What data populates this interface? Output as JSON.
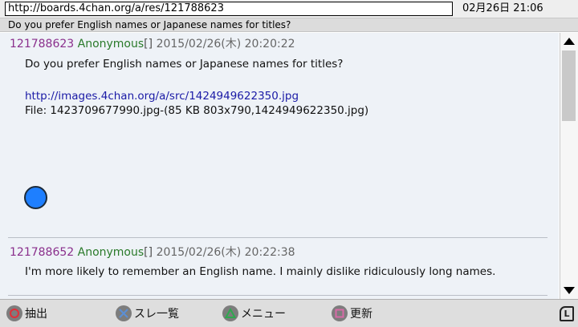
{
  "address_bar": {
    "url": "http://boards.4chan.org/a/res/121788623"
  },
  "clock": {
    "date_time": "02月26日  21:06"
  },
  "thread": {
    "title": "Do you prefer English names or Japanese names for titles?"
  },
  "posts": [
    {
      "number": "121788623",
      "name": "Anonymous",
      "mail": "[]",
      "date": "2015/02/26(木) 20:20:22",
      "body": "Do you prefer English names or Japanese names for titles?",
      "image_link": "http://images.4chan.org/a/src/1424949622350.jpg",
      "file_info": "File: 1423709677990.jpg-(85 KB 803x790,1424949622350.jpg)"
    },
    {
      "number": "121788652",
      "name": "Anonymous",
      "mail": "[]",
      "date": "2015/02/26(木) 20:22:38",
      "body": "I'm more likely to remember an English name. I mainly dislike ridiculously long names."
    }
  ],
  "bottom_bar": {
    "circle_label": "抽出",
    "cross_label": "スレ一覧",
    "triangle_label": "メニュー",
    "square_label": "更新",
    "l_label": "L"
  },
  "colors": {
    "post_number": "#8a2f8c",
    "post_name": "#2a7a2a",
    "link": "#1a1aa6",
    "marker": "#1e7fff",
    "circle_button": "#e0303a",
    "cross_button": "#5b8fd6",
    "triangle_button": "#2fa84f",
    "square_button": "#d96aa8"
  },
  "icons": {
    "circle": "circle-button-icon",
    "cross": "cross-button-icon",
    "triangle": "triangle-button-icon",
    "square": "square-button-icon",
    "l": "l-button-icon",
    "marker": "blue-dot-icon"
  }
}
